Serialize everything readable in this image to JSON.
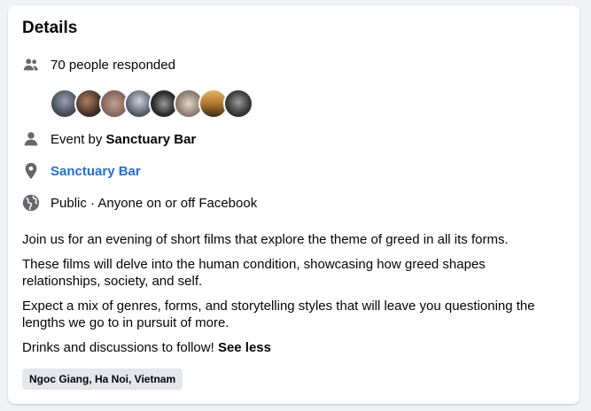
{
  "details": {
    "title": "Details",
    "responded": "70 people responded",
    "event_by_prefix": "Event by ",
    "event_by_name": "Sanctuary Bar",
    "location": "Sanctuary Bar",
    "privacy": "Public · Anyone on or off Facebook",
    "description": [
      "Join us for an evening of short films that explore the theme of greed in all its forms.",
      "These films will delve into the human condition, showcasing how greed shapes relationships, society, and self.",
      "Expect a mix of genres, forms, and storytelling styles that will leave you questioning the lengths we go to in pursuit of more.",
      "Drinks and discussions to follow! "
    ],
    "see_less": "See less",
    "tag": "Ngoc Giang, Ha Noi, Vietnam"
  },
  "colors": {
    "link": "#216fdb",
    "icon": "#65676b",
    "chip_bg": "#e4e6eb"
  },
  "avatars": [
    {
      "color": "#4b4f5c"
    },
    {
      "color": "#3a2a25"
    },
    {
      "color": "#8a6a5d"
    },
    {
      "color": "#5c6470"
    },
    {
      "color": "#2a2a2a"
    },
    {
      "color": "#8e8072"
    },
    {
      "color": "#b0782e"
    },
    {
      "color": "#3d3d3d"
    }
  ]
}
